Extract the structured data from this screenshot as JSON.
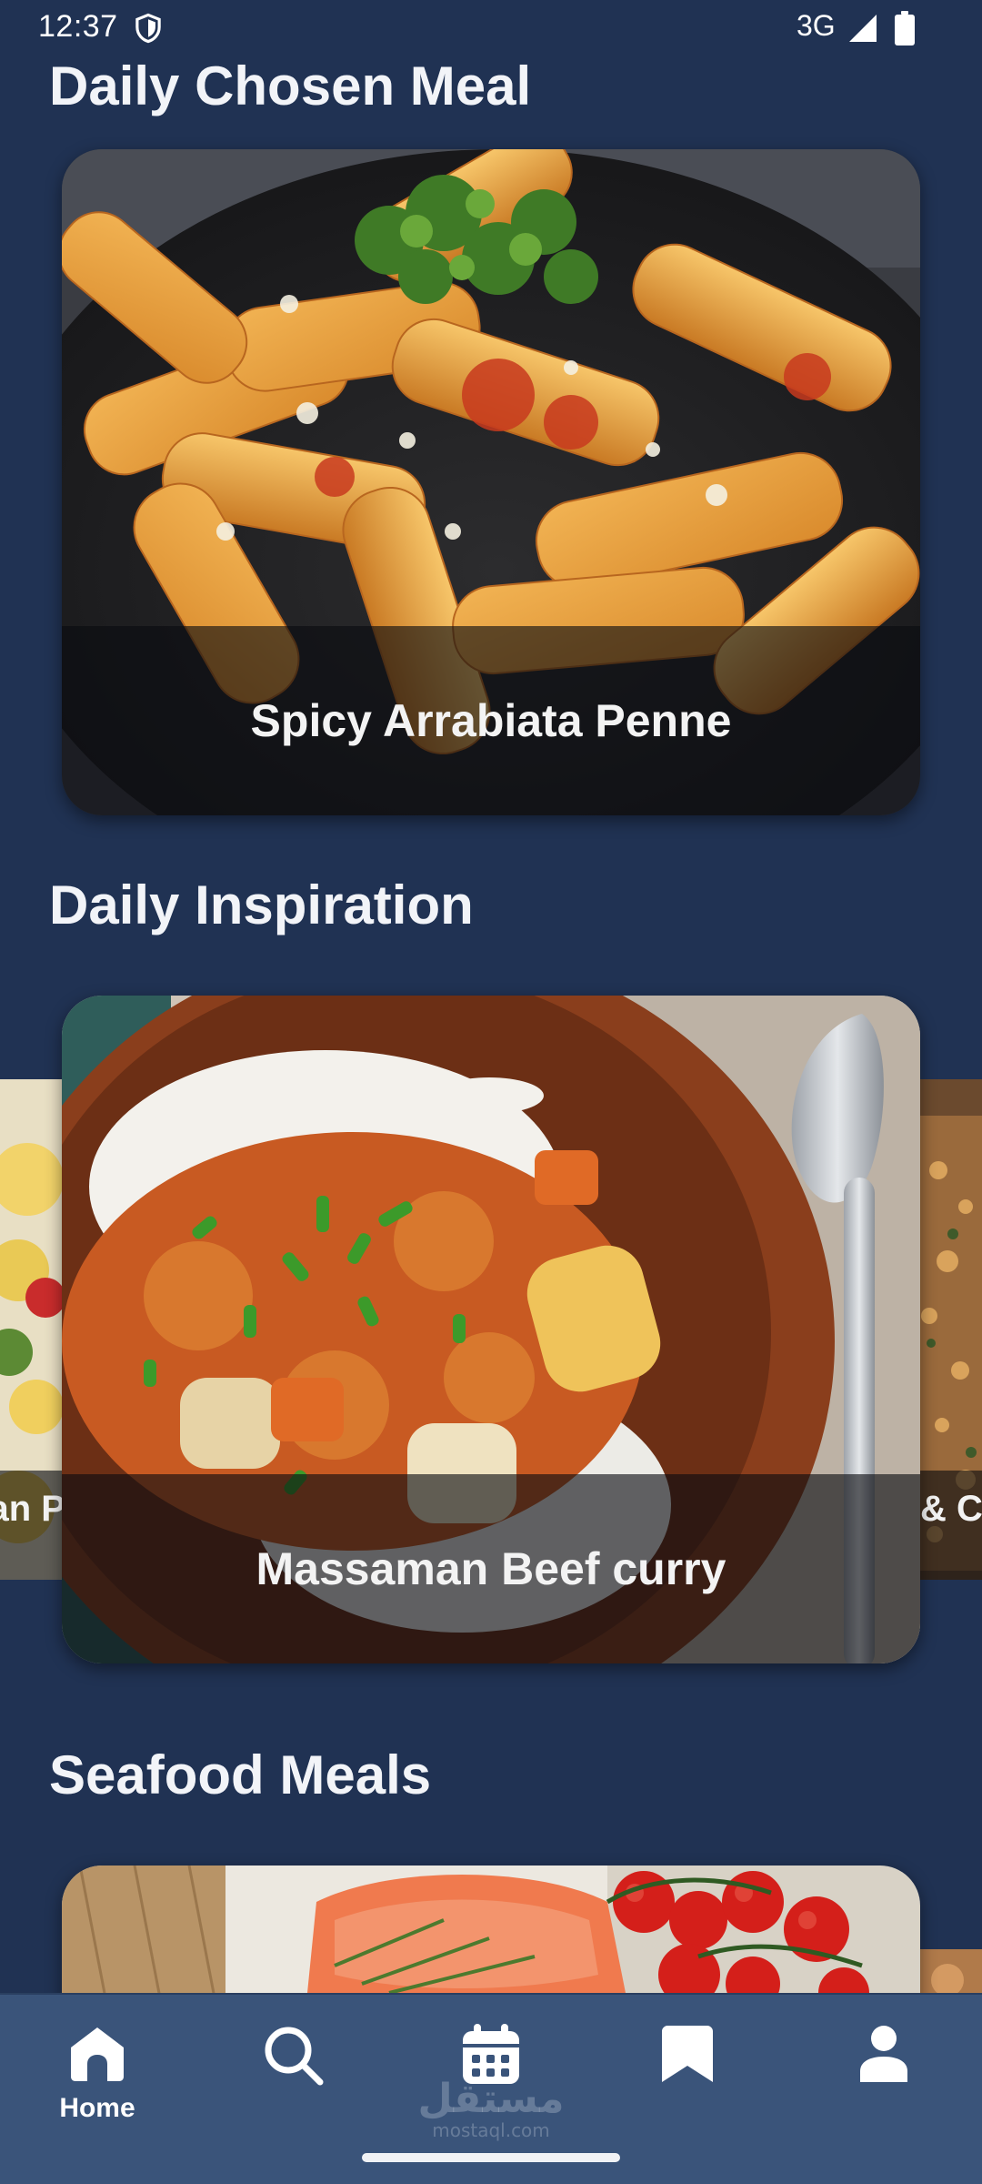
{
  "status_bar": {
    "time": "12:37",
    "network": "3G",
    "icons": [
      "shield-icon",
      "signal-icon",
      "battery-icon"
    ]
  },
  "sections": {
    "daily_chosen": {
      "title": "Daily Chosen Meal",
      "meal_name": "Spicy Arrabiata Penne"
    },
    "daily_inspiration": {
      "title": "Daily Inspiration",
      "meal_name": "Massaman Beef curry",
      "prev_peek_caption": "an P",
      "next_peek_caption": "& Ch"
    },
    "seafood": {
      "title": "Seafood Meals"
    }
  },
  "bottom_nav": {
    "items": [
      {
        "icon": "home-icon",
        "label": "Home",
        "active": true
      },
      {
        "icon": "search-icon",
        "label": ""
      },
      {
        "icon": "calendar-icon",
        "label": ""
      },
      {
        "icon": "bookmark-icon",
        "label": ""
      },
      {
        "icon": "profile-icon",
        "label": ""
      }
    ]
  },
  "watermark": {
    "arabic": "مستقل",
    "latin": "mostaql.com"
  },
  "colors": {
    "background": "#203253",
    "nav_background": "#3a547a",
    "caption_overlay": "rgba(10,12,16,0.62)",
    "text": "#f2f4f8"
  }
}
